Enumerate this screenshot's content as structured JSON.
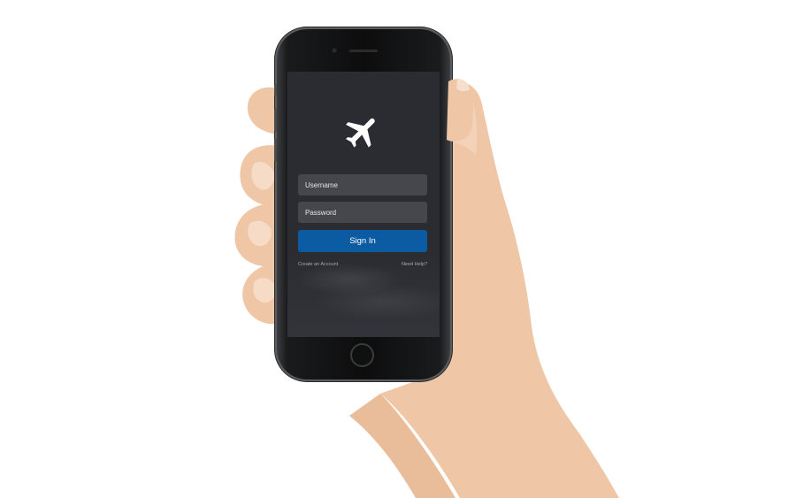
{
  "login": {
    "username_placeholder": "Username",
    "password_placeholder": "Password",
    "signin_label": "Sign In",
    "create_account_label": "Create an Account",
    "help_label": "Need Help?"
  },
  "colors": {
    "screen_background": "#2b2c31",
    "input_background": "#46474c",
    "signin_button": "#0b5ba2",
    "skin": "#efc6a6"
  },
  "icons": {
    "logo": "airplane-icon"
  }
}
